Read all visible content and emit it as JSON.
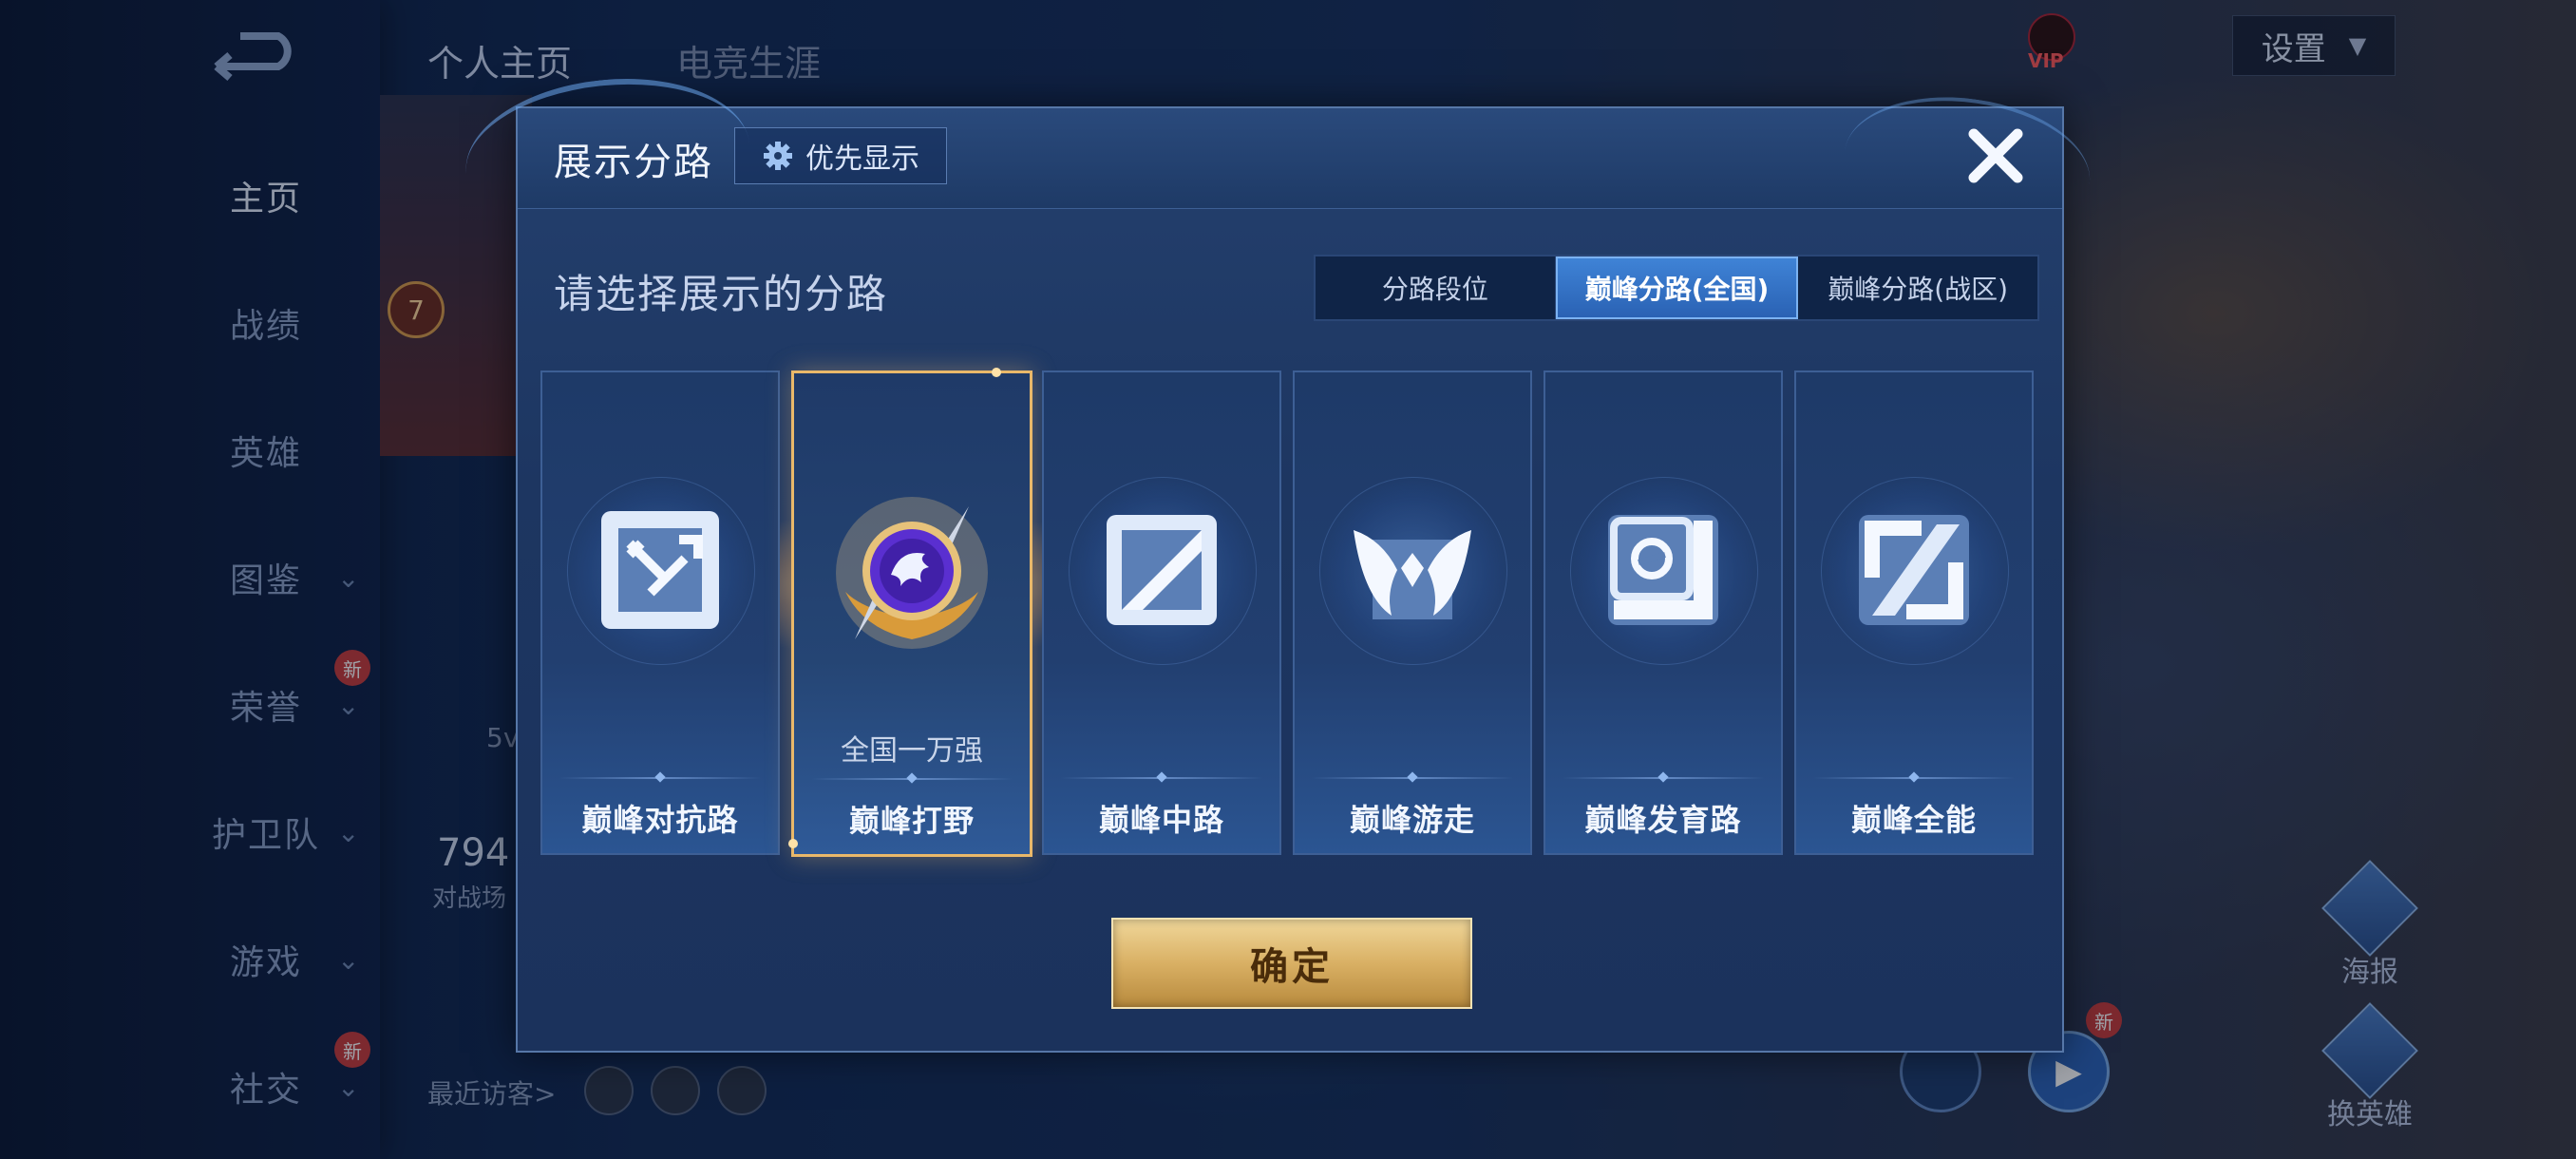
{
  "background": {
    "top_tabs": [
      "个人主页",
      "电竞生涯"
    ],
    "nav_items": [
      {
        "label": "主页",
        "active": true,
        "chevron": false,
        "new": false
      },
      {
        "label": "战绩",
        "active": false,
        "chevron": false,
        "new": false
      },
      {
        "label": "英雄",
        "active": false,
        "chevron": false,
        "new": false
      },
      {
        "label": "图鉴",
        "active": false,
        "chevron": true,
        "new": false
      },
      {
        "label": "荣誉",
        "active": false,
        "chevron": true,
        "new": true
      },
      {
        "label": "护卫队",
        "active": false,
        "chevron": true,
        "new": false
      },
      {
        "label": "游戏",
        "active": false,
        "chevron": true,
        "new": false
      },
      {
        "label": "社交",
        "active": false,
        "chevron": true,
        "new": true
      }
    ],
    "new_badge": "新",
    "settings_label": "设置",
    "vip_label": "VIP",
    "level_badge": "7",
    "stat_value": "794",
    "stat_caption": "对战场",
    "small_text": "5v",
    "visitors_label": "最近访客>",
    "right_actions": [
      "海报",
      "换英雄"
    ]
  },
  "dialog": {
    "title": "展示分路",
    "priority_button": "优先显示",
    "subtitle": "请选择展示的分路",
    "segments": [
      {
        "label": "分路段位",
        "active": false
      },
      {
        "label": "巅峰分路(全国)",
        "active": true
      },
      {
        "label": "巅峰分路(战区)",
        "active": false
      }
    ],
    "cards": [
      {
        "label": "巅峰对抗路",
        "icon": "clash-lane-icon",
        "selected": false,
        "rank": ""
      },
      {
        "label": "巅峰打野",
        "icon": "jungle-dragon-emblem-icon",
        "selected": true,
        "rank": "全国一万强"
      },
      {
        "label": "巅峰中路",
        "icon": "mid-lane-icon",
        "selected": false,
        "rank": ""
      },
      {
        "label": "巅峰游走",
        "icon": "roam-wings-icon",
        "selected": false,
        "rank": ""
      },
      {
        "label": "巅峰发育路",
        "icon": "farm-lane-icon",
        "selected": false,
        "rank": ""
      },
      {
        "label": "巅峰全能",
        "icon": "all-round-icon",
        "selected": false,
        "rank": ""
      }
    ],
    "confirm_button": "确定"
  },
  "colors": {
    "accent_blue": "#3f83d6",
    "gold": "#d9b064",
    "selected_border": "#e9b86a"
  }
}
